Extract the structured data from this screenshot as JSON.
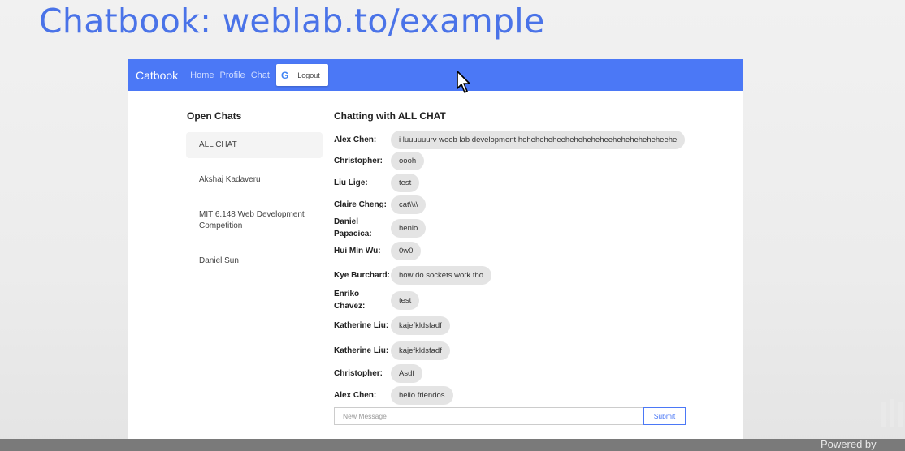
{
  "slide": {
    "title": "Chatbook: weblab.to/example"
  },
  "navbar": {
    "brand": "Catbook",
    "links": [
      "Home",
      "Profile",
      "Chat"
    ],
    "logout_label": "Logout",
    "google_glyph": "G"
  },
  "sidebar": {
    "title": "Open Chats",
    "chats": [
      {
        "label": "ALL CHAT",
        "active": true
      },
      {
        "label": "Akshaj Kadaveru"
      },
      {
        "label": "MIT 6.148 Web Development Competition"
      },
      {
        "label": "Daniel Sun"
      }
    ]
  },
  "chat": {
    "title": "Chatting with ALL CHAT",
    "messages": [
      {
        "author": "Alex Chen:",
        "text": "i luuuuuurv weeb lab development heheheheheeheheheheheeheheheheheheehe"
      },
      {
        "author": "Christopher:",
        "text": "oooh"
      },
      {
        "author": "Liu Lige:",
        "text": "test"
      },
      {
        "author": "Claire Cheng:",
        "text": "cat\\\\\\\\"
      },
      {
        "author": "Daniel Papacica:",
        "text": "henlo"
      },
      {
        "author": "Hui Min Wu:",
        "text": "0w0"
      },
      {
        "author": "Kye Burchard:",
        "text": "how do sockets work tho"
      },
      {
        "author": "Enriko Chavez:",
        "text": "test"
      },
      {
        "author": "Katherine Liu:",
        "text": "kajefkldsfadf"
      },
      {
        "author": "Katherine Liu:",
        "text": "kajefkldsfadf"
      },
      {
        "author": "Christopher:",
        "text": "Asdf"
      },
      {
        "author": "Alex Chen:",
        "text": "hello friendos"
      }
    ],
    "input_placeholder": "New Message",
    "submit_label": "Submit"
  },
  "footer": {
    "watermark": "Powered by"
  },
  "colors": {
    "accent": "#4b78f6",
    "title": "#4a73e8",
    "bubble": "#e4e4e4"
  }
}
